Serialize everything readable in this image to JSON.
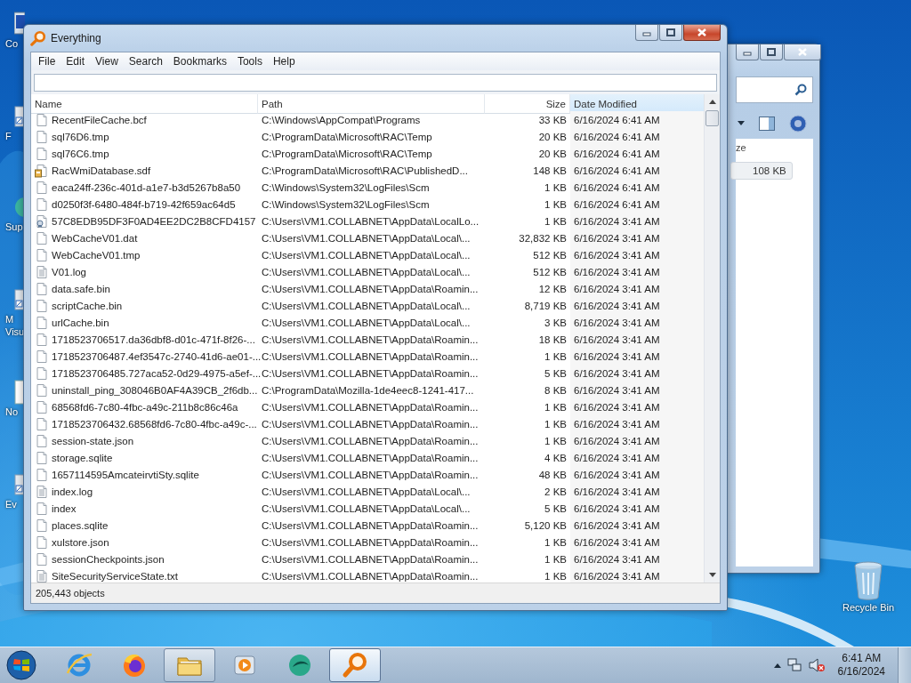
{
  "desktop_icons": [
    {
      "kind": "computer",
      "lines": [
        "Co"
      ]
    },
    {
      "kind": "app",
      "lines": [
        "F"
      ]
    },
    {
      "kind": "globe",
      "lines": [
        "Sup"
      ]
    },
    {
      "kind": "app",
      "lines": [
        "M",
        "Visu"
      ]
    },
    {
      "kind": "document",
      "lines": [
        "No"
      ]
    },
    {
      "kind": "app",
      "lines": [
        "Ev"
      ]
    }
  ],
  "recycle_bin": {
    "label": "Recycle Bin"
  },
  "background_window": {
    "column_label": "ze",
    "size_value": "108 KB"
  },
  "window": {
    "title": "Everything",
    "menu": [
      "File",
      "Edit",
      "View",
      "Search",
      "Bookmarks",
      "Tools",
      "Help"
    ],
    "columns": [
      {
        "label": "Name",
        "sorted": false
      },
      {
        "label": "Path",
        "sorted": false
      },
      {
        "label": "Size",
        "sorted": false
      },
      {
        "label": "Date Modified",
        "sorted": true
      }
    ],
    "rows": [
      {
        "kind": "file",
        "name": "RecentFileCache.bcf",
        "path": "C:\\Windows\\AppCompat\\Programs",
        "size": "33 KB",
        "date": "6/16/2024 6:41 AM"
      },
      {
        "kind": "file",
        "name": "sql76D6.tmp",
        "path": "C:\\ProgramData\\Microsoft\\RAC\\Temp",
        "size": "20 KB",
        "date": "6/16/2024 6:41 AM"
      },
      {
        "kind": "file",
        "name": "sql76C6.tmp",
        "path": "C:\\ProgramData\\Microsoft\\RAC\\Temp",
        "size": "20 KB",
        "date": "6/16/2024 6:41 AM"
      },
      {
        "kind": "database",
        "name": "RacWmiDatabase.sdf",
        "path": "C:\\ProgramData\\Microsoft\\RAC\\PublishedD...",
        "size": "148 KB",
        "date": "6/16/2024 6:41 AM"
      },
      {
        "kind": "file",
        "name": "eaca24ff-236c-401d-a1e7-b3d5267b8a50",
        "path": "C:\\Windows\\System32\\LogFiles\\Scm",
        "size": "1 KB",
        "date": "6/16/2024 6:41 AM"
      },
      {
        "kind": "file",
        "name": "d0250f3f-6480-484f-b719-42f659ac64d5",
        "path": "C:\\Windows\\System32\\LogFiles\\Scm",
        "size": "1 KB",
        "date": "6/16/2024 6:41 AM"
      },
      {
        "kind": "certificate",
        "name": "57C8EDB95DF3F0AD4EE2DC2B8CFD4157",
        "path": "C:\\Users\\VM1.COLLABNET\\AppData\\LocalLo...",
        "size": "1 KB",
        "date": "6/16/2024 3:41 AM"
      },
      {
        "kind": "file",
        "name": "WebCacheV01.dat",
        "path": "C:\\Users\\VM1.COLLABNET\\AppData\\Local\\...",
        "size": "32,832 KB",
        "date": "6/16/2024 3:41 AM"
      },
      {
        "kind": "file",
        "name": "WebCacheV01.tmp",
        "path": "C:\\Users\\VM1.COLLABNET\\AppData\\Local\\...",
        "size": "512 KB",
        "date": "6/16/2024 3:41 AM"
      },
      {
        "kind": "text",
        "name": "V01.log",
        "path": "C:\\Users\\VM1.COLLABNET\\AppData\\Local\\...",
        "size": "512 KB",
        "date": "6/16/2024 3:41 AM"
      },
      {
        "kind": "file",
        "name": "data.safe.bin",
        "path": "C:\\Users\\VM1.COLLABNET\\AppData\\Roamin...",
        "size": "12 KB",
        "date": "6/16/2024 3:41 AM"
      },
      {
        "kind": "file",
        "name": "scriptCache.bin",
        "path": "C:\\Users\\VM1.COLLABNET\\AppData\\Local\\...",
        "size": "8,719 KB",
        "date": "6/16/2024 3:41 AM"
      },
      {
        "kind": "file",
        "name": "urlCache.bin",
        "path": "C:\\Users\\VM1.COLLABNET\\AppData\\Local\\...",
        "size": "3 KB",
        "date": "6/16/2024 3:41 AM"
      },
      {
        "kind": "file",
        "name": "1718523706517.da36dbf8-d01c-471f-8f26-...",
        "path": "C:\\Users\\VM1.COLLABNET\\AppData\\Roamin...",
        "size": "18 KB",
        "date": "6/16/2024 3:41 AM"
      },
      {
        "kind": "file",
        "name": "1718523706487.4ef3547c-2740-41d6-ae01-...",
        "path": "C:\\Users\\VM1.COLLABNET\\AppData\\Roamin...",
        "size": "1 KB",
        "date": "6/16/2024 3:41 AM"
      },
      {
        "kind": "file",
        "name": "1718523706485.727aca52-0d29-4975-a5ef-...",
        "path": "C:\\Users\\VM1.COLLABNET\\AppData\\Roamin...",
        "size": "5 KB",
        "date": "6/16/2024 3:41 AM"
      },
      {
        "kind": "file",
        "name": "uninstall_ping_308046B0AF4A39CB_2f6db...",
        "path": "C:\\ProgramData\\Mozilla-1de4eec8-1241-417...",
        "size": "8 KB",
        "date": "6/16/2024 3:41 AM"
      },
      {
        "kind": "file",
        "name": "68568fd6-7c80-4fbc-a49c-211b8c86c46a",
        "path": "C:\\Users\\VM1.COLLABNET\\AppData\\Roamin...",
        "size": "1 KB",
        "date": "6/16/2024 3:41 AM"
      },
      {
        "kind": "file",
        "name": "1718523706432.68568fd6-7c80-4fbc-a49c-...",
        "path": "C:\\Users\\VM1.COLLABNET\\AppData\\Roamin...",
        "size": "1 KB",
        "date": "6/16/2024 3:41 AM"
      },
      {
        "kind": "file",
        "name": "session-state.json",
        "path": "C:\\Users\\VM1.COLLABNET\\AppData\\Roamin...",
        "size": "1 KB",
        "date": "6/16/2024 3:41 AM"
      },
      {
        "kind": "file",
        "name": "storage.sqlite",
        "path": "C:\\Users\\VM1.COLLABNET\\AppData\\Roamin...",
        "size": "4 KB",
        "date": "6/16/2024 3:41 AM"
      },
      {
        "kind": "file",
        "name": "1657114595AmcateirvtiSty.sqlite",
        "path": "C:\\Users\\VM1.COLLABNET\\AppData\\Roamin...",
        "size": "48 KB",
        "date": "6/16/2024 3:41 AM"
      },
      {
        "kind": "text",
        "name": "index.log",
        "path": "C:\\Users\\VM1.COLLABNET\\AppData\\Local\\...",
        "size": "2 KB",
        "date": "6/16/2024 3:41 AM"
      },
      {
        "kind": "file",
        "name": "index",
        "path": "C:\\Users\\VM1.COLLABNET\\AppData\\Local\\...",
        "size": "5 KB",
        "date": "6/16/2024 3:41 AM"
      },
      {
        "kind": "file",
        "name": "places.sqlite",
        "path": "C:\\Users\\VM1.COLLABNET\\AppData\\Roamin...",
        "size": "5,120 KB",
        "date": "6/16/2024 3:41 AM"
      },
      {
        "kind": "file",
        "name": "xulstore.json",
        "path": "C:\\Users\\VM1.COLLABNET\\AppData\\Roamin...",
        "size": "1 KB",
        "date": "6/16/2024 3:41 AM"
      },
      {
        "kind": "file",
        "name": "sessionCheckpoints.json",
        "path": "C:\\Users\\VM1.COLLABNET\\AppData\\Roamin...",
        "size": "1 KB",
        "date": "6/16/2024 3:41 AM"
      },
      {
        "kind": "text",
        "name": "SiteSecurityServiceState.txt",
        "path": "C:\\Users\\VM1.COLLABNET\\AppData\\Roamin...",
        "size": "1 KB",
        "date": "6/16/2024 3:41 AM"
      }
    ],
    "status_bar": "205,443 objects"
  },
  "taskbar": {
    "items": [
      {
        "kind": "ie",
        "selected": false,
        "open": false
      },
      {
        "kind": "firefox",
        "selected": false,
        "open": false
      },
      {
        "kind": "explorer",
        "selected": false,
        "open": true
      },
      {
        "kind": "media",
        "selected": false,
        "open": false
      },
      {
        "kind": "app",
        "selected": false,
        "open": false
      },
      {
        "kind": "everything",
        "selected": true,
        "open": true
      }
    ],
    "clock": {
      "time": "6:41 AM",
      "date": "6/16/2024"
    }
  }
}
